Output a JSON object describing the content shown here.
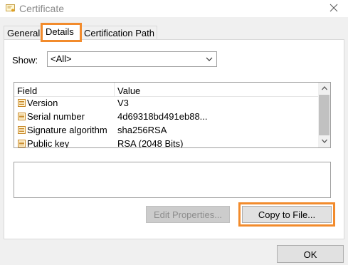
{
  "window": {
    "title": "Certificate",
    "icon": "certificate-icon",
    "close_icon": "close-icon"
  },
  "tabs": [
    {
      "label": "General",
      "active": false
    },
    {
      "label": "Details",
      "active": true
    },
    {
      "label": "Certification Path",
      "active": false
    }
  ],
  "show": {
    "label": "Show:",
    "selected": "<All>"
  },
  "field_list": {
    "columns": [
      "Field",
      "Value"
    ],
    "rows": [
      {
        "field": "Version",
        "value": "V3"
      },
      {
        "field": "Serial number",
        "value": "4d69318bd491eb88..."
      },
      {
        "field": "Signature algorithm",
        "value": "sha256RSA"
      },
      {
        "field": "Public key",
        "value": "RSA (2048 Bits)"
      }
    ]
  },
  "buttons": {
    "edit_properties": "Edit Properties...",
    "copy_to_file": "Copy to File...",
    "ok": "OK"
  },
  "colors": {
    "highlight": "#f28b2c",
    "panel_bg": "#ffffff",
    "window_bg": "#f0f0f0"
  }
}
